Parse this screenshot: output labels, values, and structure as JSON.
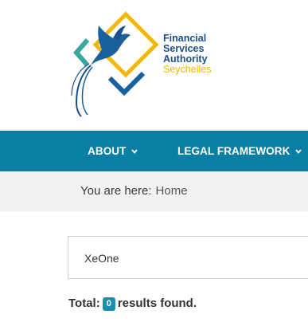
{
  "logo": {
    "line1": "Financial",
    "line2": "Services",
    "line3": "Authority",
    "line4": "Seychelles",
    "colors": {
      "primary": "#1a4f8b",
      "accent": "#f2b705",
      "teal": "#3aa8a0"
    }
  },
  "nav": {
    "items": [
      {
        "label": "ABOUT",
        "icon": "chevron-down-icon"
      },
      {
        "label": "LEGAL FRAMEWORK",
        "icon": "chevron-down-icon"
      }
    ],
    "background": "#0a7fa3"
  },
  "breadcrumb": {
    "prefix": "You are here:",
    "current": "Home"
  },
  "search": {
    "value": "XeOne"
  },
  "results": {
    "total_label": "Total:",
    "count": "0",
    "suffix": "results found."
  }
}
